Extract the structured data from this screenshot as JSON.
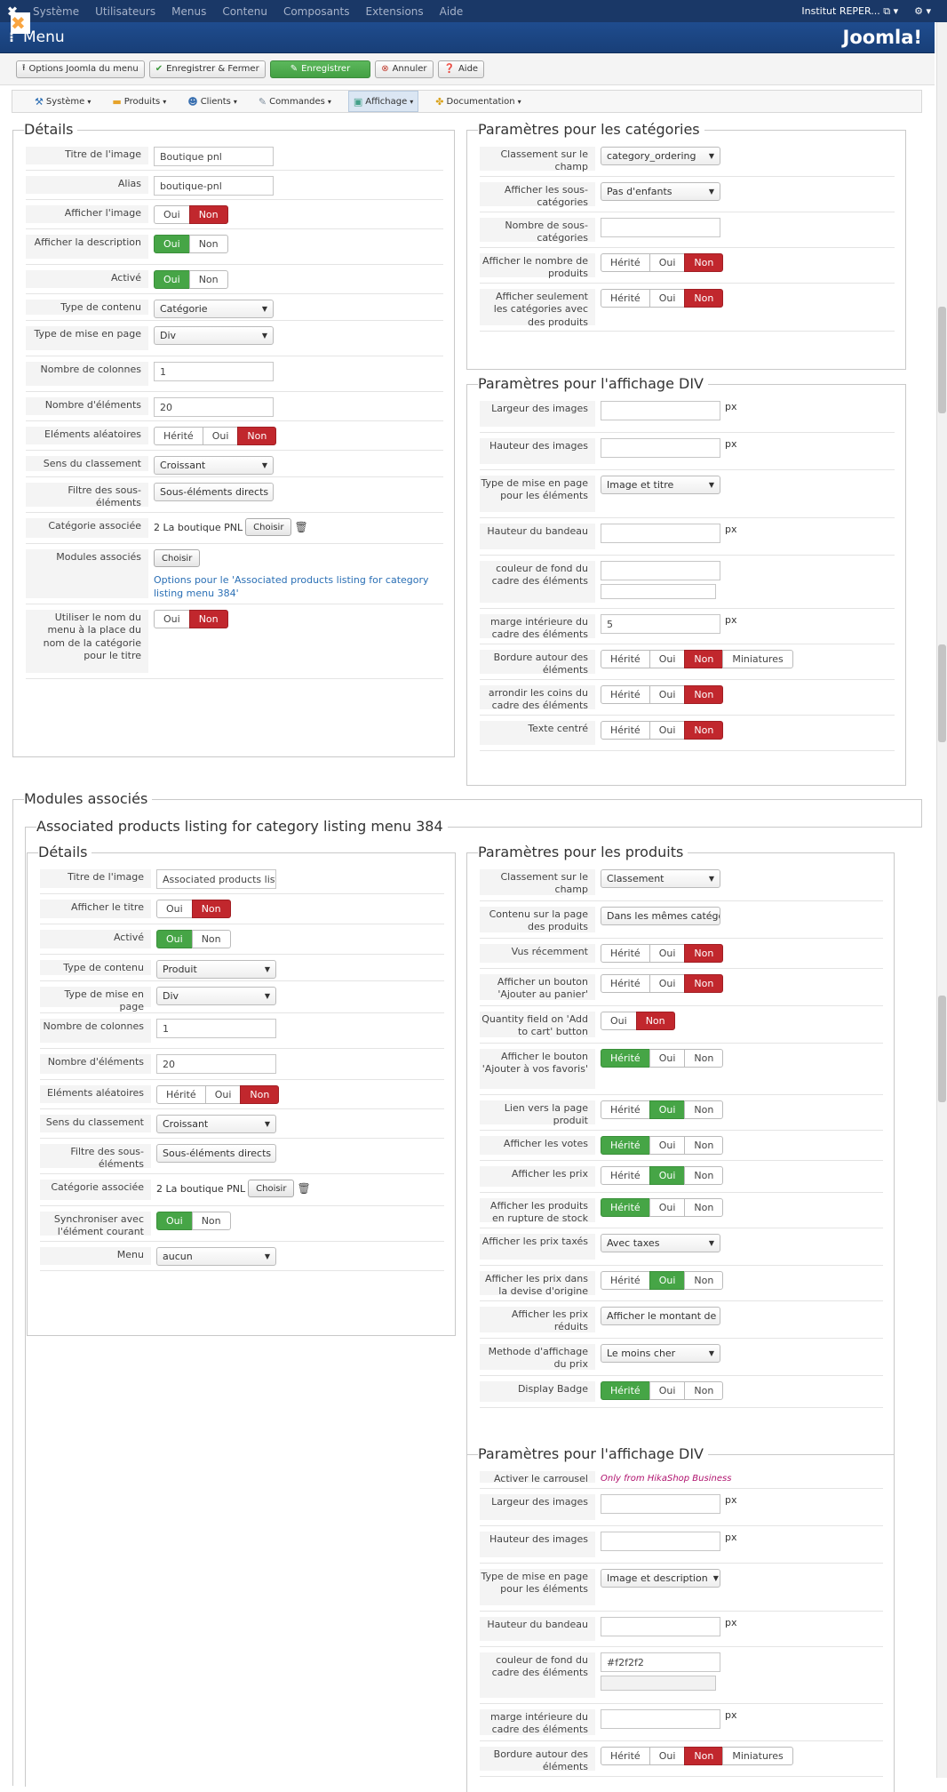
{
  "topbar": {
    "menus": [
      "Système",
      "Utilisateurs",
      "Menus",
      "Contenu",
      "Composants",
      "Extensions",
      "Aide"
    ],
    "site": "Institut REPER... ⧉ ▾",
    "gear": "⚙ ▾"
  },
  "header": {
    "title": "Menu",
    "brand": "Joomla!"
  },
  "toolbar": {
    "options": "Options Joomla du menu",
    "save_close": "Enregistrer & Fermer",
    "save": "Enregistrer",
    "cancel": "Annuler",
    "help": "Aide"
  },
  "hikamenu": [
    {
      "label": "Système",
      "icon": "⚒",
      "color": "#2b6db3"
    },
    {
      "label": "Produits",
      "icon": "▬",
      "color": "#e6a32a"
    },
    {
      "label": "Clients",
      "icon": "☻",
      "color": "#3a70b0"
    },
    {
      "label": "Commandes",
      "icon": "✎",
      "color": "#7a8a99"
    },
    {
      "label": "Affichage",
      "icon": "▣",
      "color": "#44a089",
      "active": true
    },
    {
      "label": "Documentation",
      "icon": "✤",
      "color": "#d9a21b"
    }
  ],
  "menu_details": {
    "legend": "Détails",
    "rows": [
      {
        "label": "Titre de l'image",
        "type": "input",
        "value": "Boutique pnl",
        "h": 33
      },
      {
        "label": "Alias",
        "type": "input",
        "value": "boutique-pnl",
        "h": 33
      },
      {
        "label": "Afficher l'image",
        "type": "toggle",
        "options": [
          "Oui",
          "Non"
        ],
        "selected": 1,
        "h": 33
      },
      {
        "label": "Afficher la description",
        "type": "toggle",
        "options": [
          "Oui",
          "Non"
        ],
        "selected": 0,
        "h": 40
      },
      {
        "label": "Activé",
        "type": "toggle",
        "options": [
          "Oui",
          "Non"
        ],
        "selected": 0,
        "h": 33
      },
      {
        "label": "Type de contenu",
        "type": "select",
        "value": "Catégorie",
        "h": 30
      },
      {
        "label": "Type de mise en page",
        "type": "select",
        "value": "Div",
        "h": 40
      },
      {
        "label": "Nombre de colonnes",
        "type": "input",
        "value": "1",
        "h": 40
      },
      {
        "label": "Nombre d'éléments",
        "type": "input",
        "value": "20",
        "h": 33
      },
      {
        "label": "Eléments aléatoires",
        "type": "toggle",
        "options": [
          "Hérité",
          "Oui",
          "Non"
        ],
        "selected": 2,
        "h": 33
      },
      {
        "label": "Sens du classement",
        "type": "select",
        "value": "Croissant",
        "h": 30
      },
      {
        "label": "Filtre des sous-éléments",
        "type": "select",
        "value": "Sous-éléments directs",
        "h": 40
      },
      {
        "label": "Catégorie associée",
        "type": "category",
        "value": "2 La boutique PNL",
        "button": "Choisir",
        "h": 35
      },
      {
        "label": "Modules associés",
        "type": "modules",
        "button": "Choisir",
        "link": "Options pour le 'Associated products listing for category listing menu 384'",
        "h": 68
      },
      {
        "label": "Utiliser le nom du menu à la place du nom de la catégorie pour le titre",
        "type": "toggle",
        "options": [
          "Oui",
          "Non"
        ],
        "selected": 1,
        "h": 84
      }
    ]
  },
  "menu_categories": {
    "legend": "Paramètres pour les catégories",
    "rows": [
      {
        "label": "Classement sur le champ",
        "type": "select",
        "value": "category_ordering",
        "h": 40
      },
      {
        "label": "Afficher les sous-catégories",
        "type": "select",
        "value": "Pas d'enfants",
        "h": 40
      },
      {
        "label": "Nombre de sous-catégories",
        "type": "input",
        "value": "",
        "h": 40
      },
      {
        "label": "Afficher le nombre de produits",
        "type": "toggle",
        "options": [
          "Hérité",
          "Oui",
          "Non"
        ],
        "selected": 2,
        "h": 40
      },
      {
        "label": "Afficher seulement les catégories avec des produits",
        "type": "toggle",
        "options": [
          "Hérité",
          "Oui",
          "Non"
        ],
        "selected": 2,
        "h": 54
      }
    ]
  },
  "menu_div": {
    "legend": "Paramètres pour l'affichage DIV",
    "rows": [
      {
        "label": "Largeur des images",
        "type": "inputpx",
        "value": "",
        "unit": "px",
        "h": 42
      },
      {
        "label": "Hauteur des images",
        "type": "inputpx",
        "value": "",
        "unit": "px",
        "h": 42
      },
      {
        "label": "Type de mise en page pour les éléments",
        "type": "select",
        "value": "Image et titre",
        "h": 54
      },
      {
        "label": "Hauteur du bandeau",
        "type": "inputpx",
        "value": "",
        "unit": "px",
        "h": 42
      },
      {
        "label": "couleur de fond du cadre des éléments",
        "type": "color",
        "value": "",
        "h": 60
      },
      {
        "label": "marge intérieure du cadre des éléments",
        "type": "inputpx",
        "value": "5",
        "unit": "px",
        "h": 40
      },
      {
        "label": "Bordure autour des éléments",
        "type": "toggle",
        "options": [
          "Hérité",
          "Oui",
          "Non",
          "Miniatures"
        ],
        "selected": 2,
        "h": 40
      },
      {
        "label": "arrondir les coins du cadre des éléments",
        "type": "toggle",
        "options": [
          "Hérité",
          "Oui",
          "Non"
        ],
        "selected": 2,
        "h": 40
      },
      {
        "label": "Texte centré",
        "type": "toggle",
        "options": [
          "Hérité",
          "Oui",
          "Non"
        ],
        "selected": 2,
        "h": 40
      }
    ]
  },
  "modules": {
    "legend": "Modules associés",
    "subtitle": "Associated products listing for category listing menu 384"
  },
  "mod_details": {
    "legend": "Détails",
    "rows": [
      {
        "label": "Titre de l'image",
        "type": "input",
        "value": "Associated products listing for c",
        "h": 34
      },
      {
        "label": "Afficher le titre",
        "type": "toggle",
        "options": [
          "Oui",
          "Non"
        ],
        "selected": 1,
        "h": 34
      },
      {
        "label": "Activé",
        "type": "toggle",
        "options": [
          "Oui",
          "Non"
        ],
        "selected": 0,
        "h": 34
      },
      {
        "label": "Type de contenu",
        "type": "select",
        "value": "Produit",
        "h": 30
      },
      {
        "label": "Type de mise en page",
        "type": "select",
        "value": "Div",
        "h": 36
      },
      {
        "label": "Nombre de colonnes",
        "type": "input",
        "value": "1",
        "h": 40
      },
      {
        "label": "Nombre d'éléments",
        "type": "input",
        "value": "20",
        "h": 35
      },
      {
        "label": "Eléments aléatoires",
        "type": "toggle",
        "options": [
          "Hérité",
          "Oui",
          "Non"
        ],
        "selected": 2,
        "h": 33
      },
      {
        "label": "Sens du classement",
        "type": "select",
        "value": "Croissant",
        "h": 33
      },
      {
        "label": "Filtre des sous-éléments",
        "type": "select",
        "value": "Sous-éléments directs",
        "h": 40
      },
      {
        "label": "Catégorie associée",
        "type": "category",
        "value": "2 La boutique PNL",
        "button": "Choisir",
        "h": 36
      },
      {
        "label": "Synchroniser avec l'élément courant",
        "type": "toggle",
        "options": [
          "Oui",
          "Non"
        ],
        "selected": 0,
        "h": 40
      },
      {
        "label": "Menu",
        "type": "select",
        "value": "aucun",
        "h": 33
      }
    ]
  },
  "mod_products": {
    "legend": "Paramètres pour les produits",
    "rows": [
      {
        "label": "Classement sur le champ",
        "type": "select",
        "value": "Classement",
        "h": 42
      },
      {
        "label": "Contenu sur la page des produits",
        "type": "select",
        "value": "Dans les mêmes catégories",
        "h": 42
      },
      {
        "label": "Vus récemment",
        "type": "toggle",
        "options": [
          "Hérité",
          "Oui",
          "Non"
        ],
        "selected": 2,
        "h": 34
      },
      {
        "label": "Afficher un bouton 'Ajouter au panier'",
        "type": "toggle",
        "options": [
          "Hérité",
          "Oui",
          "Non"
        ],
        "selected": 2,
        "h": 42
      },
      {
        "label": "Quantity field on 'Add to cart' button",
        "type": "toggle",
        "options": [
          "Oui",
          "Non"
        ],
        "selected": 1,
        "h": 42
      },
      {
        "label": "Afficher le bouton 'Ajouter à vos favoris'",
        "type": "toggle",
        "options": [
          "Hérité",
          "Oui",
          "Non"
        ],
        "selected": 0,
        "h": 58
      },
      {
        "label": "Lien vers la page produit",
        "type": "toggle",
        "options": [
          "Hérité",
          "Oui",
          "Non"
        ],
        "selected": 1,
        "h": 40
      },
      {
        "label": "Afficher les votes",
        "type": "toggle",
        "options": [
          "Hérité",
          "Oui",
          "Non"
        ],
        "selected": 0,
        "h": 34
      },
      {
        "label": "Afficher les prix",
        "type": "toggle",
        "options": [
          "Hérité",
          "Oui",
          "Non"
        ],
        "selected": 1,
        "h": 36
      },
      {
        "label": "Afficher les produits en rupture de stock",
        "type": "toggle",
        "options": [
          "Hérité",
          "Oui",
          "Non"
        ],
        "selected": 0,
        "h": 40
      },
      {
        "label": "Afficher les prix taxés",
        "type": "select",
        "value": "Avec taxes",
        "h": 42
      },
      {
        "label": "Afficher les prix dans la devise d'origine",
        "type": "toggle",
        "options": [
          "Hérité",
          "Oui",
          "Non"
        ],
        "selected": 1,
        "h": 40
      },
      {
        "label": "Afficher les prix réduits",
        "type": "select",
        "value": "Afficher le montant de la r...",
        "h": 42
      },
      {
        "label": "Methode d'affichage du prix",
        "type": "select",
        "value": "Le moins cher",
        "h": 42
      },
      {
        "label": "Display Badge",
        "type": "toggle",
        "options": [
          "Hérité",
          "Oui",
          "Non"
        ],
        "selected": 0,
        "h": 36
      }
    ]
  },
  "mod_div": {
    "legend": "Paramètres pour l'affichage DIV",
    "rows": [
      {
        "label": "Activer le carrousel",
        "type": "note",
        "value": "Only from HikaShop Business",
        "h": 26
      },
      {
        "label": "Largeur des images",
        "type": "inputpx",
        "value": "",
        "unit": "px",
        "h": 42
      },
      {
        "label": "Hauteur des images",
        "type": "inputpx",
        "value": "",
        "unit": "px",
        "h": 42
      },
      {
        "label": "Type de mise en page pour les éléments",
        "type": "select",
        "value": "Image et description",
        "h": 54
      },
      {
        "label": "Hauteur du bandeau",
        "type": "inputpx",
        "value": "",
        "unit": "px",
        "h": 40
      },
      {
        "label": "couleur de fond du cadre des éléments",
        "type": "color",
        "value": "#f2f2f2",
        "h": 64
      },
      {
        "label": "marge intérieure du cadre des éléments",
        "type": "inputpx",
        "value": "",
        "unit": "px",
        "h": 42
      },
      {
        "label": "Bordure autour des éléments",
        "type": "toggle",
        "options": [
          "Hérité",
          "Oui",
          "Non",
          "Miniatures"
        ],
        "selected": 2,
        "h": 40
      }
    ]
  }
}
